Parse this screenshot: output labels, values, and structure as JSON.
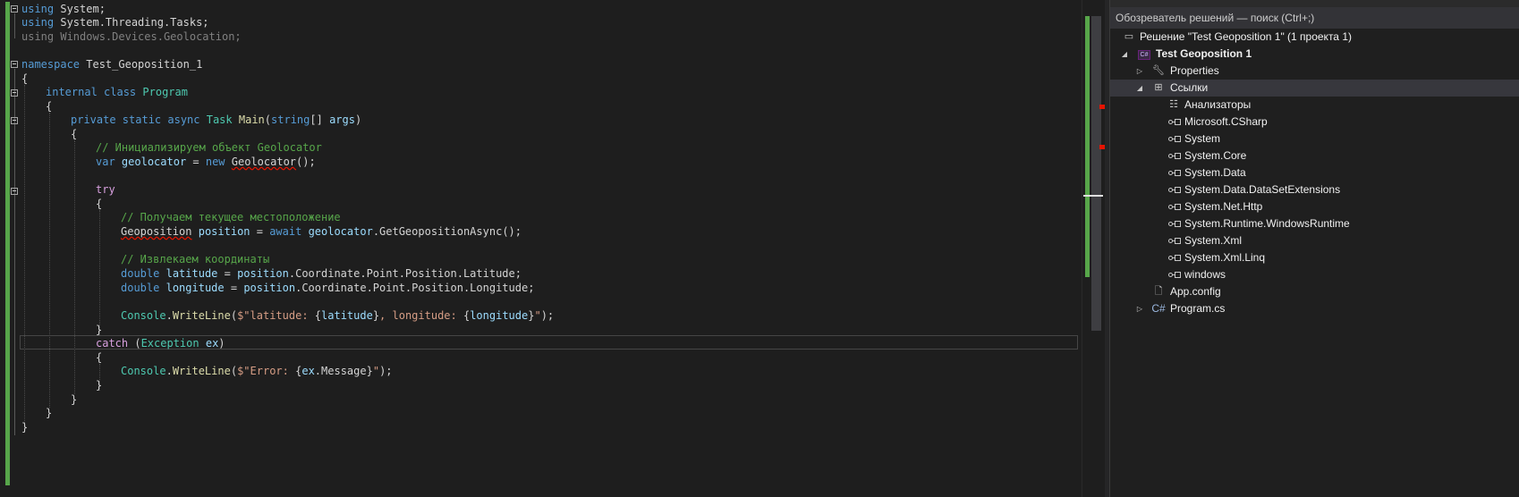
{
  "editor": {
    "lines": {
      "l1": {
        "kw": "using",
        "rest": " System;"
      },
      "l2": {
        "kw": "using",
        "rest": " System.Threading.Tasks;"
      },
      "l3": {
        "kw": "using",
        "rest": " Windows.Devices.Geolocation;"
      },
      "l5": {
        "kw": "namespace",
        "name": " Test_Geoposition_1"
      },
      "l6": "{",
      "l7": {
        "kw": "internal class",
        "name": "Program"
      },
      "l8": "{",
      "l9": {
        "kw": "private static async",
        "type": "Task",
        "method": "Main",
        "open": "(",
        "ptype": "string",
        "rest": "[] ",
        "param": "args",
        "close": ")"
      },
      "l10": "{",
      "l11": "// Инициализируем объект Geolocator",
      "l12": {
        "kw": "var",
        "var": "geolocator",
        "eq": " = ",
        "new": "new",
        "type": "Geolocator",
        "rest": "();"
      },
      "l14": "try",
      "l15": "{",
      "l16": "// Получаем текущее местоположение",
      "l17": {
        "type": "Geoposition",
        "var": "position",
        "eq": " = ",
        "await": "await",
        "obj": "geolocator",
        "method": ".GetGeopositionAsync",
        "rest": "();"
      },
      "l19": "// Извлекаем координаты",
      "l20": {
        "kw": "double",
        "var": "latitude",
        "eq": " = ",
        "chain1": "position",
        "rest": ".Coordinate.Point.Position.Latitude;"
      },
      "l21": {
        "kw": "double",
        "var": "longitude",
        "eq": " = ",
        "chain1": "position",
        "rest": ".Coordinate.Point.Position.Longitude;"
      },
      "l23": {
        "type": "Console",
        "dot": ".",
        "method": "WriteLine",
        "open": "(",
        "s1": "$\"latitude: ",
        "b1": "{",
        "v1": "latitude",
        "b2": "}",
        "s2": ", longitude: ",
        "b3": "{",
        "v2": "longitude",
        "b4": "}",
        "s3": "\"",
        "close": ");"
      },
      "l24": "}",
      "l25": {
        "kw": "catch",
        "open": " (",
        "type": "Exception",
        "sp": " ",
        "var": "ex",
        "close": ")"
      },
      "l26": "{",
      "l27": {
        "type": "Console",
        "dot": ".",
        "method": "WriteLine",
        "open": "(",
        "s1": "$\"Error: ",
        "b1": "{",
        "v1": "ex",
        "mid": ".Message",
        "b2": "}",
        "s2": "\"",
        "close": ");"
      },
      "l28": "}",
      "l29": "}",
      "l30": "}",
      "l31": "}"
    }
  },
  "solution_explorer": {
    "search_placeholder": "Обозреватель решений — поиск (Ctrl+;)",
    "solution_label": "Решение \"Test Geoposition 1\"  (1 проекта 1)",
    "project_label": "Test Geoposition 1",
    "project_icon_text": "C#",
    "properties_label": "Properties",
    "references_label": "Ссылки",
    "analyzers_label": "Анализаторы",
    "references": [
      "Microsoft.CSharp",
      "System",
      "System.Core",
      "System.Data",
      "System.Data.DataSetExtensions",
      "System.Net.Http",
      "System.Runtime.WindowsRuntime",
      "System.Xml",
      "System.Xml.Linq",
      "windows"
    ],
    "app_config_label": "App.config",
    "program_cs_label": "Program.cs",
    "program_cs_icon_text": "C#"
  },
  "colors": {
    "editor_bg": "#1e1e1e",
    "keyword": "#569cd6",
    "control_keyword": "#d8a0df",
    "type": "#4ec9b0",
    "comment": "#57a64a",
    "method": "#dcdcaa",
    "identifier": "#9cdcfe",
    "string": "#d69d85",
    "change_bar": "#57a64a",
    "error": "#e51400"
  },
  "icons": {
    "fold_toggle": "minus-box-icon",
    "properties": "wrench-icon",
    "references": "references-icon",
    "analyzers": "analyzer-icon",
    "reference_item": "assembly-reference-icon",
    "app_config": "config-file-icon",
    "csharp_file": "csharp-file-icon",
    "solution": "solution-icon",
    "expand": "triangle-right-icon",
    "collapse": "triangle-down-icon"
  }
}
